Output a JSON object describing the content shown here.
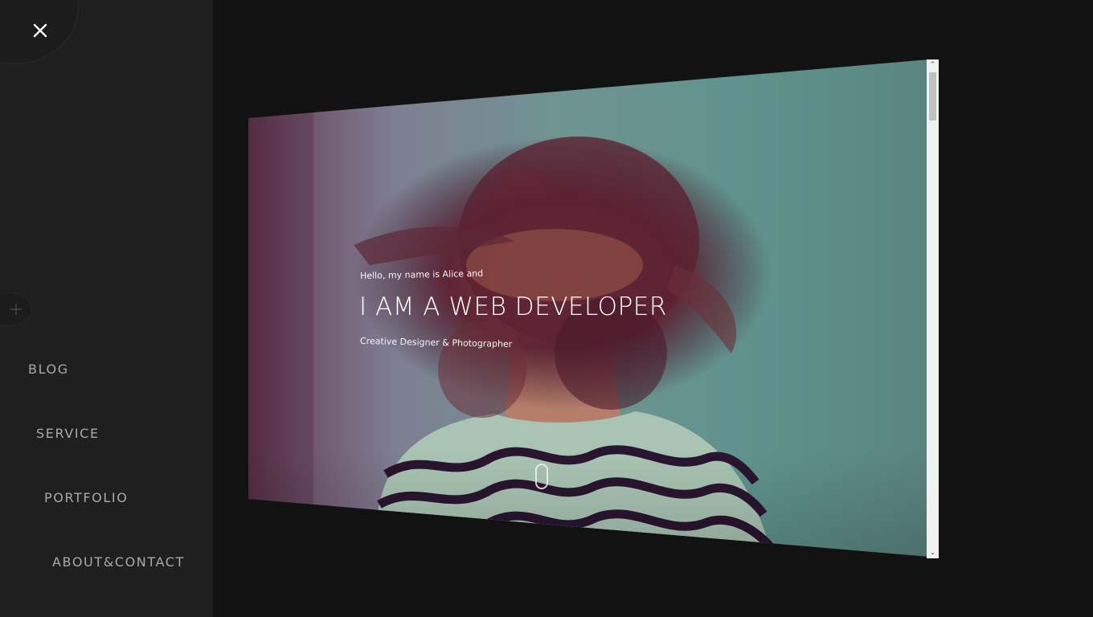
{
  "sidebar": {
    "close_icon": "close-icon",
    "plus_icon": "plus-icon",
    "nav": [
      {
        "label": "BLOG"
      },
      {
        "label": "SERVICE"
      },
      {
        "label": "PORTFOLIO"
      },
      {
        "label": "ABOUT&CONTACT"
      }
    ]
  },
  "hero": {
    "greeting": "Hello, my name is Alice and",
    "title": "I AM A WEB DEVELOPER",
    "subtitle": "Creative Designer & Photographer",
    "scroll_icon": "mouse-scroll-icon"
  },
  "scrollbar": {
    "up_glyph": "⌃",
    "down_glyph": "⌄"
  },
  "colors": {
    "page_bg": "#121212",
    "sidebar_bg": "#1f1f1f",
    "nav_text": "#a9a9a9",
    "hero_teal": "#5f928c",
    "hero_purple": "#5a2c45"
  }
}
